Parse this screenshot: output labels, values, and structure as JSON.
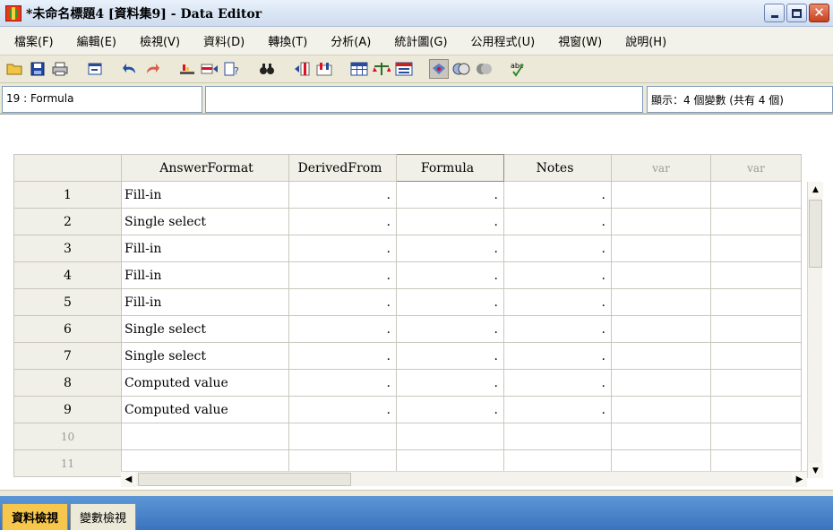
{
  "window": {
    "title": "*未命名標題4 [資料集9] - Data Editor"
  },
  "menu": {
    "items": [
      "檔案(F)",
      "編輯(E)",
      "檢視(V)",
      "資料(D)",
      "轉換(T)",
      "分析(A)",
      "統計圖(G)",
      "公用程式(U)",
      "視窗(W)",
      "說明(H)"
    ]
  },
  "toolbar": {
    "icons": [
      "open-folder-icon",
      "save-icon",
      "print-icon",
      "dialog-recall-icon",
      "undo-icon",
      "redo-icon",
      "goto-case-icon",
      "insert-case-icon",
      "variables-icon",
      "find-icon",
      "insert-variable-icon",
      "split-file-icon",
      "weight-cases-icon",
      "select-cases-icon",
      "value-labels-icon",
      "use-sets-icon",
      "show-sets-icon",
      "spell-check-icon"
    ]
  },
  "cell_editor": {
    "reference": "19 : Formula",
    "value": "",
    "variable_count": "顯示：4 個變數 (共有 4 個)"
  },
  "grid": {
    "columns": [
      "AnswerFormat",
      "DerivedFrom",
      "Formula",
      "Notes",
      "var",
      "var"
    ],
    "rows": [
      {
        "num": "1",
        "answer": "Fill-in",
        "derived": ".",
        "formula": ".",
        "notes": "."
      },
      {
        "num": "2",
        "answer": "Single select",
        "derived": ".",
        "formula": ".",
        "notes": "."
      },
      {
        "num": "3",
        "answer": "Fill-in",
        "derived": ".",
        "formula": ".",
        "notes": "."
      },
      {
        "num": "4",
        "answer": "Fill-in",
        "derived": ".",
        "formula": ".",
        "notes": "."
      },
      {
        "num": "5",
        "answer": "Fill-in",
        "derived": ".",
        "formula": ".",
        "notes": "."
      },
      {
        "num": "6",
        "answer": "Single select",
        "derived": ".",
        "formula": ".",
        "notes": "."
      },
      {
        "num": "7",
        "answer": "Single select",
        "derived": ".",
        "formula": ".",
        "notes": "."
      },
      {
        "num": "8",
        "answer": "Computed value",
        "derived": ".",
        "formula": ".",
        "notes": "."
      },
      {
        "num": "9",
        "answer": "Computed value",
        "derived": ".",
        "formula": ".",
        "notes": "."
      },
      {
        "num": "10",
        "answer": "",
        "derived": "",
        "formula": "",
        "notes": ""
      },
      {
        "num": "11",
        "answer": "",
        "derived": "",
        "formula": "",
        "notes": ""
      }
    ]
  },
  "tabs": {
    "data_view": "資料檢視",
    "variable_view": "變數檢視"
  },
  "colors": {
    "active_tab": "#f7c64c",
    "tab_bar": "#3a74be",
    "header_bg": "#f0efe8"
  }
}
